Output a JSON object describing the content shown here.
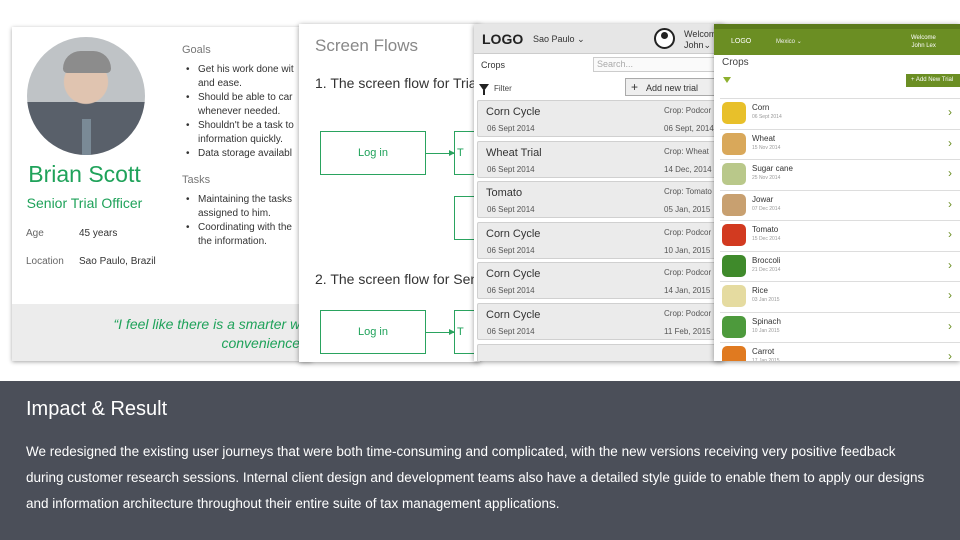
{
  "persona": {
    "name": "Brian Scott",
    "role": "Senior Trial Officer",
    "age_label": "Age",
    "age_value": "45 years",
    "location_label": "Location",
    "location_value": "Sao Paulo, Brazil",
    "goals_label": "Goals",
    "goals": [
      "Get his work done wit",
      "and ease.",
      "Should be able to car",
      "whenever needed.",
      "Shouldn't be a task to",
      "information quickly.",
      "Data storage availabl"
    ],
    "tasks_label": "Tasks",
    "tasks": [
      "Maintaining the tasks",
      "assigned to him.",
      "Coordinating with the",
      "the information."
    ],
    "quote_line1": "“I feel like there is a smarter wa",
    "quote_line2": "convenience,"
  },
  "flows": {
    "title": "Screen Flows",
    "flow1": "1. The screen flow for Tria",
    "flow2": "2. The screen flow for Sen",
    "login1": "Log in",
    "login2": "Log in",
    "stub_letter": "T"
  },
  "tablet": {
    "logo": "LOGO",
    "city": "Sao Paulo",
    "welcome_line1": "Welcom",
    "welcome_line2": "John",
    "crops_heading": "Crops",
    "search_placeholder": "Search...",
    "filter_label": "Filter",
    "add_trial": "Add new trial",
    "rows": [
      {
        "title": "Corn Cycle",
        "date": "06 Sept 2014",
        "crop": "Crop: Podcor",
        "date2": "06 Sept, 2014"
      },
      {
        "title": "Wheat Trial",
        "date": "06 Sept 2014",
        "crop": "Crop: Wheat",
        "date2": "14 Dec, 2014"
      },
      {
        "title": "Tomato",
        "date": "06 Sept 2014",
        "crop": "Crop: Tomato",
        "date2": "05 Jan, 2015"
      },
      {
        "title": "Corn Cycle",
        "date": "06 Sept 2014",
        "crop": "Crop: Podcor",
        "date2": "10 Jan, 2015"
      },
      {
        "title": "Corn Cycle",
        "date": "06 Sept 2014",
        "crop": "Crop: Podcor",
        "date2": "14 Jan, 2015"
      },
      {
        "title": "Corn Cycle",
        "date": "06 Sept 2014",
        "crop": "Crop: Podcor",
        "date2": "11 Feb, 2015"
      }
    ]
  },
  "phone": {
    "logo": "LOGO",
    "country": "Mexico",
    "welcome_line1": "Welcome",
    "welcome_line2": "John Lex",
    "heading": "Crops",
    "add_trial": "Add New Trial",
    "accent": "#6b8e23",
    "crops": [
      {
        "name": "Corn",
        "date": "06 Sept 2014",
        "color": "#e8c02a"
      },
      {
        "name": "Wheat",
        "date": "15 Nov 2014",
        "color": "#d9a85a"
      },
      {
        "name": "Sugar cane",
        "date": "25 Nov 2014",
        "color": "#b9c88a"
      },
      {
        "name": "Jowar",
        "date": "07 Dec 2014",
        "color": "#c8a070"
      },
      {
        "name": "Tomato",
        "date": "15 Dec 2014",
        "color": "#d23a20"
      },
      {
        "name": "Broccoli",
        "date": "21 Dec 2014",
        "color": "#3f8a2b"
      },
      {
        "name": "Rice",
        "date": "03 Jan 2015",
        "color": "#e5dba0"
      },
      {
        "name": "Spinach",
        "date": "10 Jan 2015",
        "color": "#4d9a3c"
      },
      {
        "name": "Carrot",
        "date": "17 Jan 2015",
        "color": "#e07a20"
      }
    ]
  },
  "result": {
    "heading": "Impact & Result",
    "body": "We redesigned the existing user journeys that were both time-consuming and complicated, with the new versions receiving very positive feedback during customer research sessions. Internal client design and development teams also have a detailed style guide to enable them to apply our designs and information architecture throughout their entire suite of tax management applications."
  }
}
